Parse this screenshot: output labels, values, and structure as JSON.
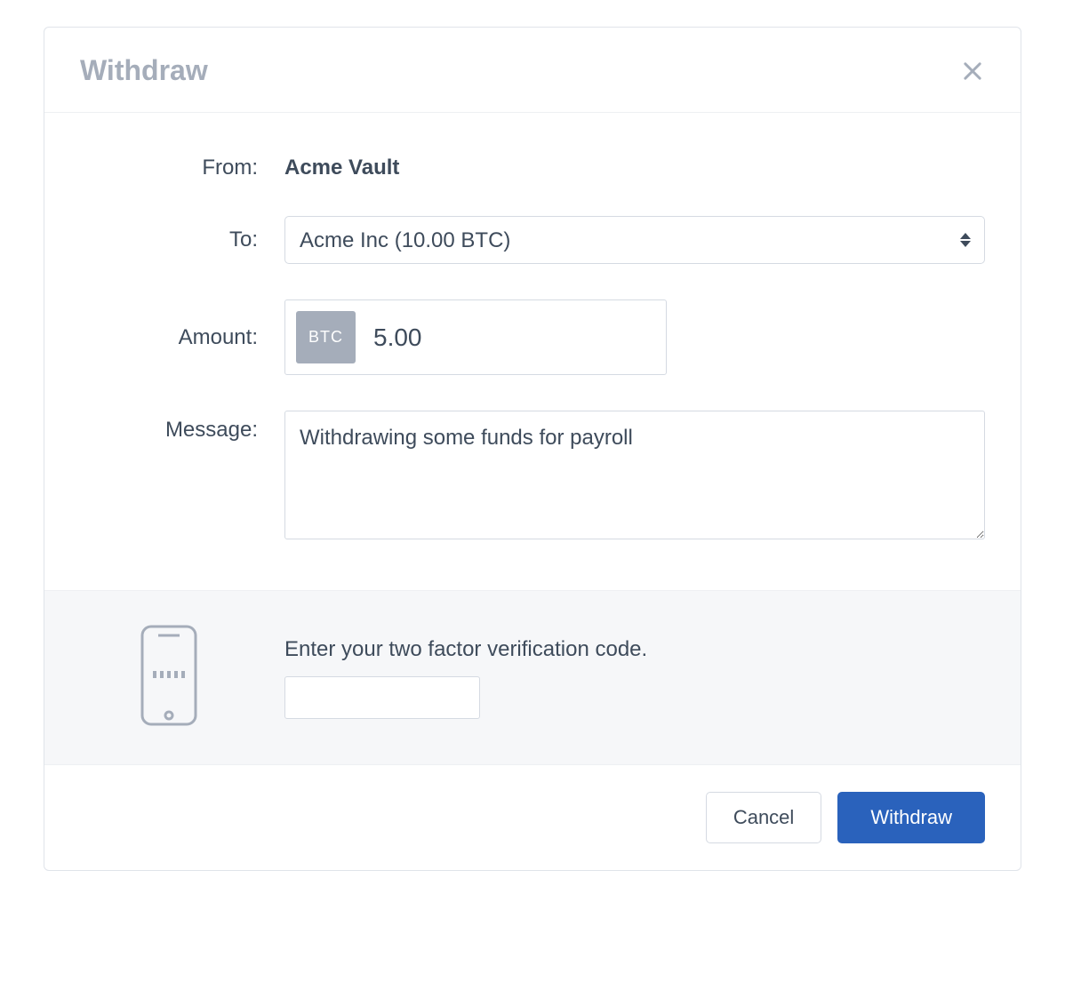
{
  "modal": {
    "title": "Withdraw"
  },
  "form": {
    "from_label": "From:",
    "from_value": "Acme Vault",
    "to_label": "To:",
    "to_selected": "Acme Inc (10.00 BTC)",
    "amount_label": "Amount:",
    "amount_currency": "BTC",
    "amount_value": "5.00",
    "message_label": "Message:",
    "message_value": "Withdrawing some funds for payroll"
  },
  "twofa": {
    "label": "Enter your two factor verification code.",
    "value": ""
  },
  "footer": {
    "cancel_label": "Cancel",
    "submit_label": "Withdraw"
  }
}
